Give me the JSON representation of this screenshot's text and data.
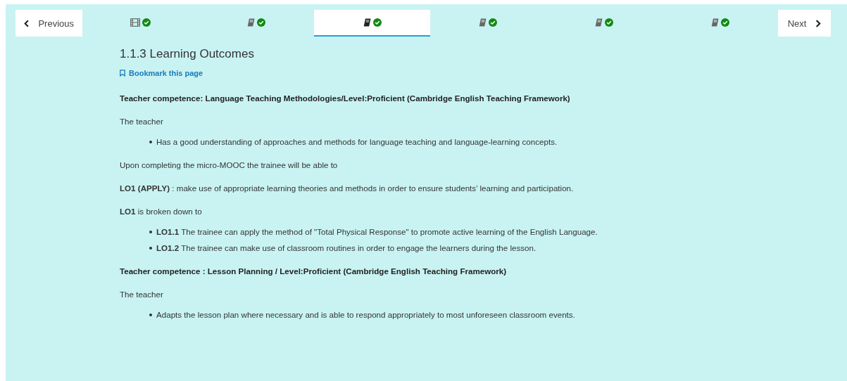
{
  "nav": {
    "previous": "Previous",
    "next": "Next"
  },
  "tabs": [
    {
      "kind": "video",
      "completed": true,
      "selected": false
    },
    {
      "kind": "book",
      "completed": true,
      "selected": false
    },
    {
      "kind": "book",
      "completed": true,
      "selected": true
    },
    {
      "kind": "book",
      "completed": true,
      "selected": false
    },
    {
      "kind": "book",
      "completed": true,
      "selected": false
    },
    {
      "kind": "book",
      "completed": true,
      "selected": false
    }
  ],
  "title": "1.1.3 Learning Outcomes",
  "bookmark": "Bookmark this page",
  "content": [
    {
      "kind": "heading",
      "text": "Teacher competence: Language Teaching Methodologies/Level:Proficient (Cambridge English Teaching Framework)"
    },
    {
      "kind": "paragraph",
      "text": "The teacher"
    },
    {
      "kind": "list",
      "items": [
        "Has a good understanding of approaches and methods for language teaching and language-learning concepts."
      ]
    },
    {
      "kind": "paragraph",
      "text": "Upon completing the micro-MOOC the trainee will be able to"
    },
    {
      "kind": "paragraph",
      "text": "**LO1 (APPLY)** : make use of appropriate learning theories and methods in order to ensure students’ learning and participation."
    },
    {
      "kind": "paragraph",
      "text": "**LO1** is broken down to"
    },
    {
      "kind": "list",
      "items": [
        "**LO1.1** The trainee can  apply the method of \"Total Physical Response\" to promote active learning of the English Language.",
        "**LO1.2** The trainee can make use of classroom routines  in order to engage the learners during the lesson."
      ]
    },
    {
      "kind": "heading",
      "text": "Teacher competence : Lesson Planning / Level:Proficient (Cambridge English Teaching Framework)"
    },
    {
      "kind": "paragraph",
      "text": "The teacher"
    },
    {
      "kind": "list",
      "items": [
        "Adapts the lesson plan where necessary and is able to respond appropriately to most unforeseen classroom events."
      ]
    }
  ]
}
